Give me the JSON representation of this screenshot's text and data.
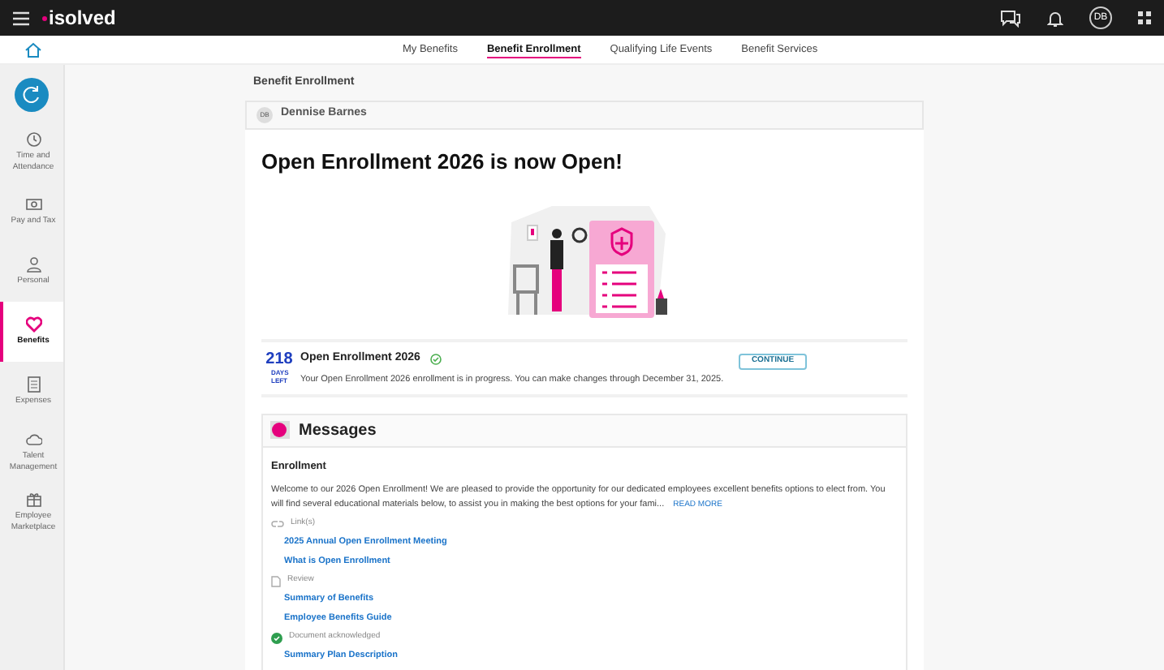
{
  "top_bar": {
    "logo": "isolved",
    "avatar": "DB"
  },
  "tabs": [
    {
      "label": "My Benefits",
      "selected": false
    },
    {
      "label": "Benefit Enrollment",
      "selected": true
    },
    {
      "label": "Qualifying Life Events",
      "selected": false
    },
    {
      "label": "Benefit Services",
      "selected": false
    }
  ],
  "sidebar": {
    "items": [
      {
        "label": "Time and Attendance",
        "kind": "clock",
        "selected": false
      },
      {
        "label": "Pay and Tax",
        "kind": "money",
        "selected": false
      },
      {
        "label": "Personal",
        "kind": "person",
        "selected": false
      },
      {
        "label": "Benefits",
        "kind": "heart",
        "selected": true
      },
      {
        "label": "Expenses",
        "kind": "calculator",
        "selected": false
      },
      {
        "label": "Talent Management",
        "kind": "cloud",
        "selected": false
      },
      {
        "label": "Employee Marketplace",
        "kind": "gift",
        "selected": false
      }
    ]
  },
  "breadcrumb": "Benefit Enrollment",
  "employee": {
    "initials": "DB",
    "name": "Dennise Barnes"
  },
  "headline": "Open Enrollment 2026 is now Open!",
  "enrollment": {
    "days": "218",
    "days_label": "DAYS LEFT",
    "title": "Open Enrollment 2026",
    "complete": true,
    "description": "Your Open Enrollment 2026 enrollment is in progress. You can make changes through December 31, 2025.",
    "button": "CONTINUE"
  },
  "messages": {
    "title": "Messages",
    "section": "Enrollment",
    "body": "Welcome to our 2026 Open Enrollment! We are pleased to provide the opportunity for our dedicated employees excellent benefits options to elect from. You will find several educational materials below, to assist you in making the best options for your fami...",
    "read_more": "READ MORE",
    "items": [
      {
        "kind": "links-header",
        "text": "Link(s)"
      },
      {
        "kind": "link",
        "text": "2025 Annual Open Enrollment Meeting"
      },
      {
        "kind": "link",
        "text": "What is Open Enrollment"
      },
      {
        "kind": "doc-header",
        "text": "Review"
      },
      {
        "kind": "link",
        "text": "Summary of Benefits"
      },
      {
        "kind": "link",
        "text": "Employee Benefits Guide"
      },
      {
        "kind": "ack",
        "text": "Document acknowledged"
      },
      {
        "kind": "link",
        "text": "Summary Plan Description"
      }
    ]
  }
}
